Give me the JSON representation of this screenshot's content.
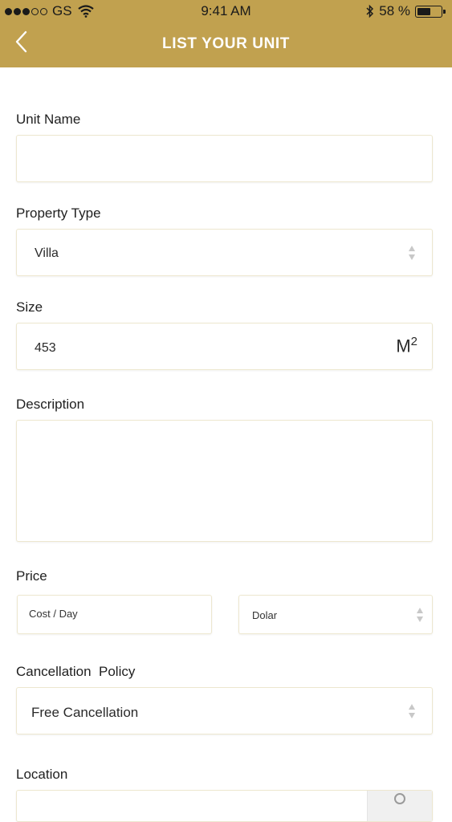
{
  "status_bar": {
    "carrier": "GS",
    "time": "9:41 AM",
    "battery": "58 %",
    "battery_level": 0.58
  },
  "header": {
    "title": "LIST YOUR UNIT"
  },
  "form": {
    "unit_name": {
      "label": "Unit Name",
      "value": ""
    },
    "property_type": {
      "label": "Property Type",
      "value": "Villa"
    },
    "size": {
      "label": "Size",
      "value": "453",
      "unit": "M",
      "unit_exp": "2"
    },
    "description": {
      "label": "Description",
      "value": ""
    },
    "price": {
      "label": "Price",
      "cost_placeholder": "Cost / Day",
      "currency": "Dolar"
    },
    "cancellation": {
      "label": "Cancellation  Policy",
      "value": "Free Cancellation"
    },
    "location": {
      "label": "Location"
    }
  },
  "icons": {
    "back": "chevron-left-icon",
    "select": "up-down-arrows-icon",
    "bluetooth": "bluetooth-icon",
    "wifi": "wifi-icon"
  }
}
